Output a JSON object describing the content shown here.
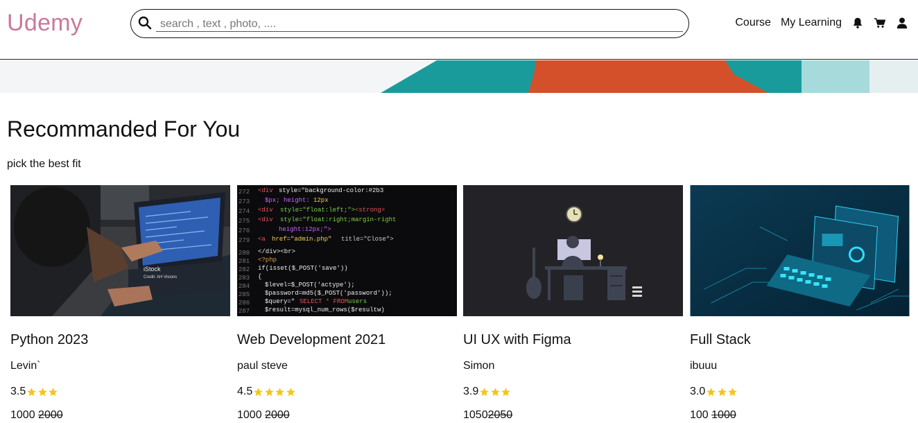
{
  "header": {
    "logo": "Udemy",
    "search_placeholder": "search , text , photo, ....",
    "nav": {
      "course": "Course",
      "my_learning": "My Learning"
    },
    "icons": [
      "bell-icon",
      "cart-icon",
      "user-icon"
    ]
  },
  "section": {
    "title": "Recommanded For You",
    "subtitle": "pick the best fit"
  },
  "courses": [
    {
      "title": "Python 2023",
      "author": "Levin`",
      "rating": "3.5",
      "stars": 3,
      "price": "1000",
      "old_price": "2000",
      "separator": " "
    },
    {
      "title": "Web Development 2021",
      "author": "paul steve",
      "rating": "4.5",
      "stars": 4,
      "price": "1000",
      "old_price": "2000",
      "separator": " "
    },
    {
      "title": "UI UX with Figma",
      "author": "Simon",
      "rating": "3.9",
      "stars": 3,
      "price": "1050",
      "old_price": "2050",
      "separator": ""
    },
    {
      "title": "Full Stack",
      "author": "ibuuu",
      "rating": "3.0",
      "stars": 3,
      "price": "100",
      "old_price": "1000",
      "separator": " "
    }
  ],
  "colors": {
    "logo": "#c9799a",
    "star": "#f5c518",
    "banner_teal": "#1a9b9b",
    "banner_orange": "#d4502a"
  }
}
